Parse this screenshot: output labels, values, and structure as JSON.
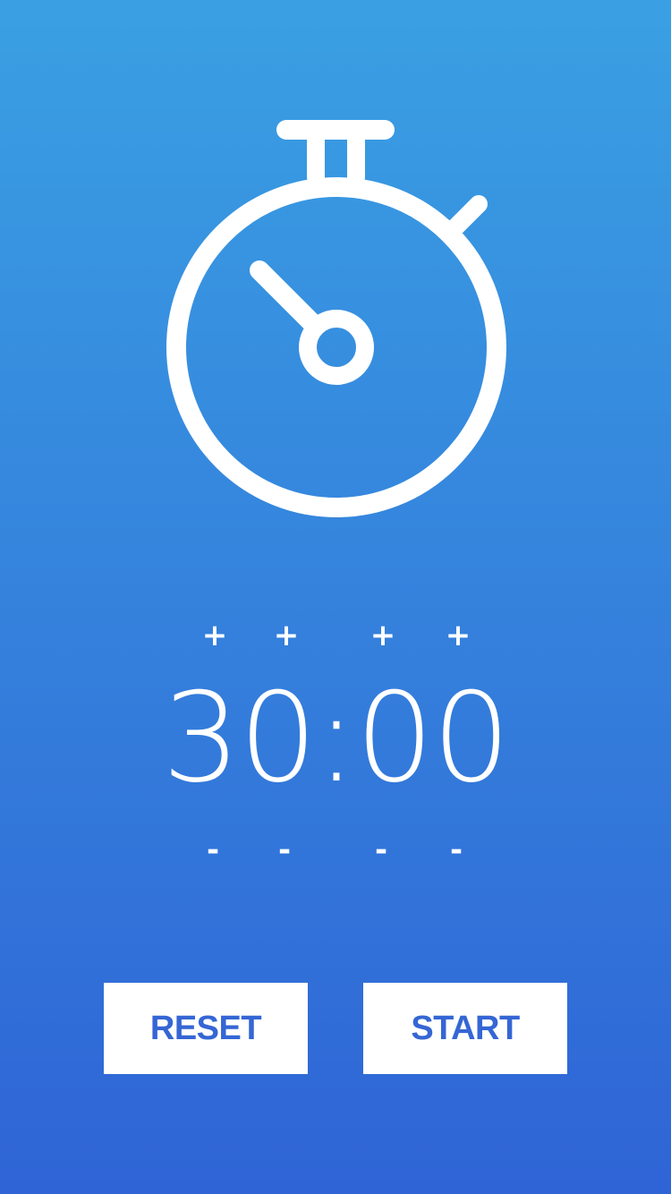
{
  "timer": {
    "display": "30:00",
    "increment_symbol": "+",
    "decrement_symbol": "-"
  },
  "controls": {
    "reset_label": "RESET",
    "start_label": "START"
  },
  "icons": {
    "stopwatch": "stopwatch-icon"
  },
  "colors": {
    "gradient_top": "#3aa0e3",
    "gradient_bottom": "#2f64d6",
    "button_text": "#3566d4",
    "foreground": "#ffffff"
  }
}
